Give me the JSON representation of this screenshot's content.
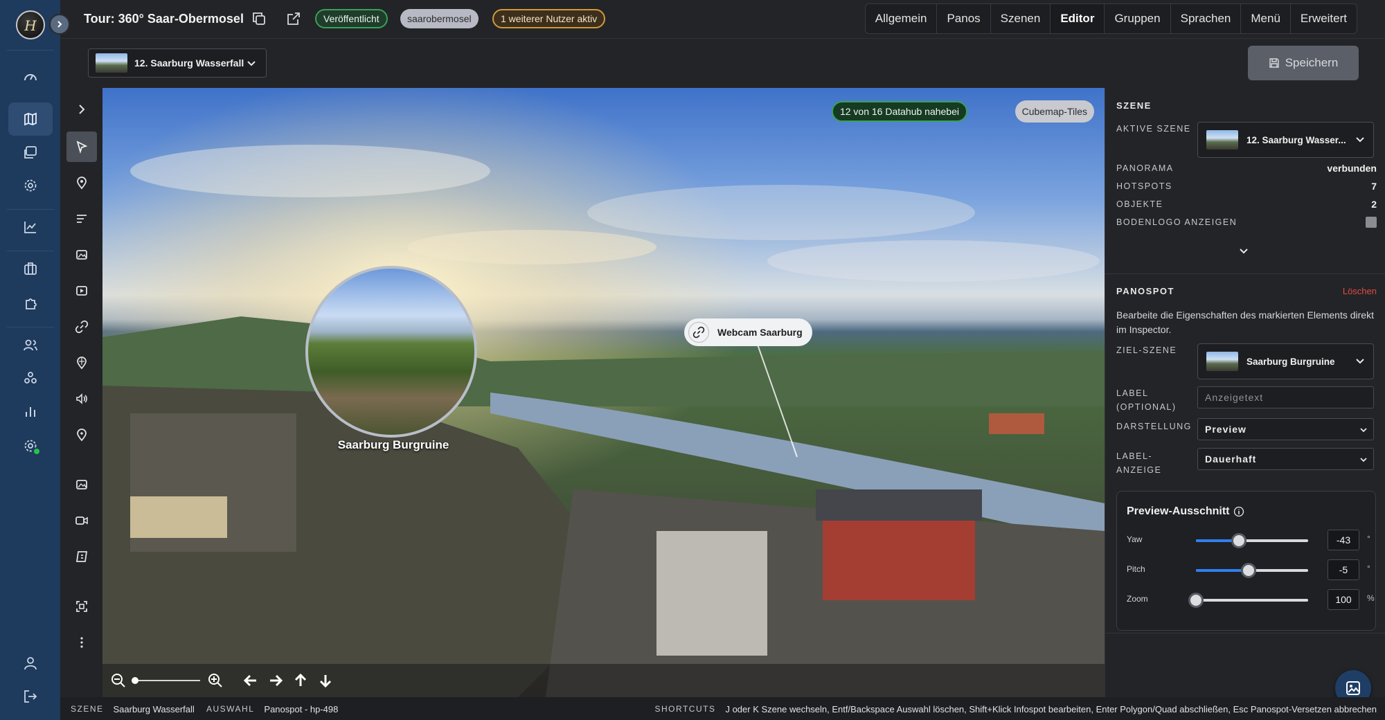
{
  "app": {
    "tour_title": "Tour: 360° Saar-Obermosel",
    "badges": {
      "published": "Veröffentlicht",
      "slug": "saarobermosel",
      "users": "1 weiterer Nutzer aktiv"
    },
    "tabs": [
      "Allgemein",
      "Panos",
      "Szenen",
      "Editor",
      "Gruppen",
      "Sprachen",
      "Menü",
      "Erweitert"
    ],
    "active_tab": "Editor"
  },
  "toolbar": {
    "scene_select": "12. Saarburg Wasserfall",
    "save_label": "Speichern"
  },
  "viewer": {
    "datahub": "12 von 16 Datahub nahebei",
    "cubemap": "Cubemap-Tiles",
    "bubble_label": "Saarburg Burgruine",
    "hotspot_label": "Webcam Saarburg"
  },
  "panel": {
    "scene": {
      "title": "SZENE",
      "active_label": "AKTIVE SZENE",
      "active_value": "12. Saarburg Wasser...",
      "rows": [
        {
          "label": "PANORAMA",
          "value": "verbunden"
        },
        {
          "label": "HOTSPOTS",
          "value": "7"
        },
        {
          "label": "OBJEKTE",
          "value": "2"
        }
      ],
      "floor_logo_label": "BODENLOGO ANZEIGEN"
    },
    "panospot": {
      "title": "PANOSPOT",
      "delete": "Löschen",
      "description": "Bearbeite die Eigenschaften des markierten Elements direkt im Inspector.",
      "target_label": "ZIEL-SZENE",
      "target_value": "Saarburg Burgruine",
      "label_label_1": "LABEL",
      "label_label_2": "(OPTIONAL)",
      "label_placeholder": "Anzeigetext",
      "display_label": "DARSTELLUNG",
      "display_value": "Preview",
      "labeldisplay_label_1": "LABEL-",
      "labeldisplay_label_2": "ANZEIGE",
      "labeldisplay_value": "Dauerhaft"
    },
    "preview": {
      "title": "Preview-Ausschnitt",
      "yaw": {
        "label": "Yaw",
        "value": "-43",
        "unit": "°",
        "level": 0.38
      },
      "pitch": {
        "label": "Pitch",
        "value": "-5",
        "unit": "°",
        "level": 0.47
      },
      "zoom": {
        "label": "Zoom",
        "value": "100",
        "unit": "%",
        "level": 0.0
      }
    }
  },
  "footer": {
    "scene_key": "SZENE",
    "scene_value": "Saarburg Wasserfall",
    "selection_key": "AUSWAHL",
    "selection_value": "Panospot - hp-498",
    "shortcuts_key": "SHORTCUTS",
    "shortcuts_value": "J oder K Szene wechseln, Entf/Backspace Auswahl löschen, Shift+Klick Infospot bearbeiten, Enter Polygon/Quad abschließen, Esc Panospot-Versetzen abbrechen"
  },
  "colors": {
    "accent": "#2f7ff0",
    "published": "#3aa05a",
    "warning": "#d39a3a",
    "danger": "#e04848",
    "rail": "#1e3a5c"
  }
}
